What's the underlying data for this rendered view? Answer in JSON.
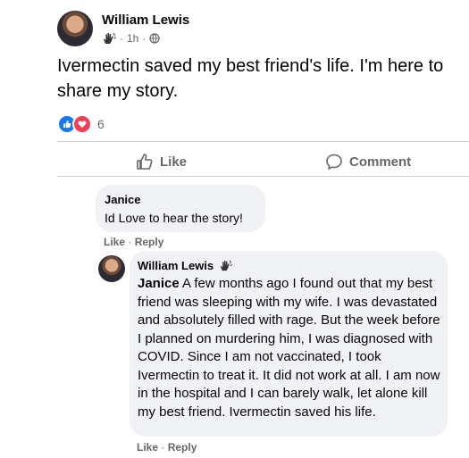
{
  "post": {
    "author": "William Lewis",
    "time": "1h",
    "sep": "·",
    "text": "Ivermectin saved my best friend's life. I'm here to share my story.",
    "reaction_count": "6",
    "reactions": [
      "like",
      "love"
    ],
    "icons": {
      "badge": "waving-hand-icon",
      "audience": "public-globe-icon"
    }
  },
  "actions": {
    "like_label": "Like",
    "comment_label": "Comment"
  },
  "comments": [
    {
      "author": "Janice",
      "text": "Id Love to hear the story!",
      "like_label": "Like",
      "reply_label": "Reply",
      "sep": "·"
    },
    {
      "author": "William Lewis",
      "mention": "Janice",
      "text": " A few months ago I found out that my best friend was sleeping with my wife. I was devastated and absolutely filled with rage. But the week before I planned on murdering him, I was diagnosed with COVID. Since I am not vaccinated, I took Ivermectin to treat it. It did not work at all. I am now in the hospital and I can barely walk, let alone kill my best friend. Ivermectin saved his life.",
      "like_label": "Like",
      "reply_label": "Reply",
      "sep": "·"
    }
  ],
  "colors": {
    "like_blue": "#1877f2",
    "love_red": "#f33e58",
    "secondary_text": "#65676b",
    "bubble_bg": "#f0f2f5"
  }
}
